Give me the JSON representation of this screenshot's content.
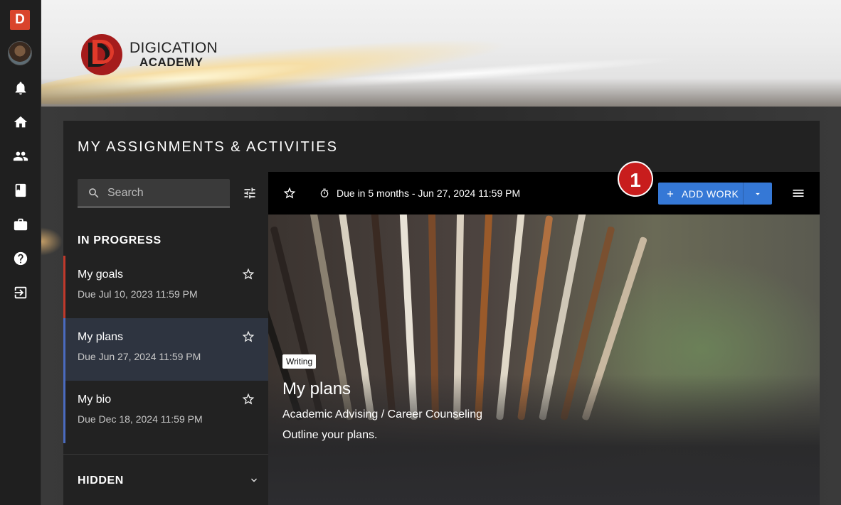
{
  "app": {
    "rail_logo": "D",
    "brand_line1": "DIGICATION",
    "brand_line2": "ACADEMY"
  },
  "colors": {
    "accent_blue": "#3578d6",
    "brand_red": "#d9442c",
    "badge_red": "#c81d1d"
  },
  "rail": {
    "items": [
      {
        "icon": "bell-icon"
      },
      {
        "icon": "home-icon"
      },
      {
        "icon": "people-icon"
      },
      {
        "icon": "book-icon"
      },
      {
        "icon": "briefcase-icon"
      },
      {
        "icon": "help-icon"
      },
      {
        "icon": "logout-icon"
      }
    ]
  },
  "page": {
    "title": "MY ASSIGNMENTS & ACTIVITIES"
  },
  "search": {
    "placeholder": "Search",
    "value": ""
  },
  "sections": {
    "in_progress": "IN PROGRESS",
    "hidden": "HIDDEN"
  },
  "assignments": [
    {
      "name": "My goals",
      "due": "Due Jul 10, 2023 11:59 PM"
    },
    {
      "name": "My plans",
      "due": "Due Jun 27, 2024 11:59 PM"
    },
    {
      "name": "My bio",
      "due": "Due Dec 18, 2024 11:59 PM"
    }
  ],
  "toolbar": {
    "due_text": "Due in 5 months - Jun 27, 2024 11:59 PM",
    "add_work_label": "ADD WORK",
    "badge_number": "1"
  },
  "detail": {
    "tag": "Writing",
    "title": "My plans",
    "subtitle": "Academic Advising / Career Counseling",
    "description": "Outline your plans."
  }
}
